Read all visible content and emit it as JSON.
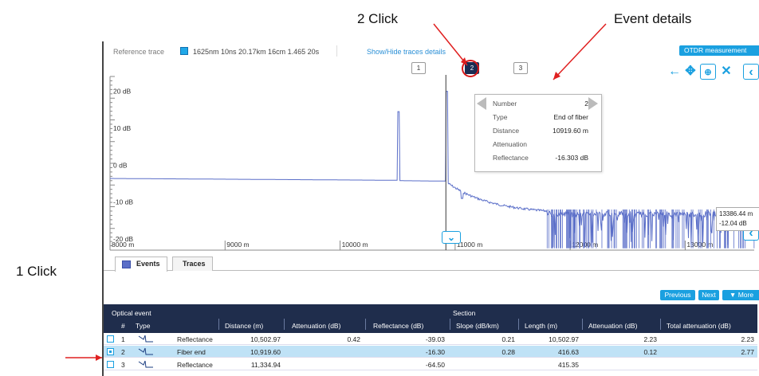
{
  "annotations": {
    "click2": "2 Click",
    "event_details": "Event details",
    "click1": "1 Click"
  },
  "info_bar": {
    "reference_label": "Reference trace",
    "trace_description": "1625nm 10ns 20.17km 16cm 1.465 20s",
    "show_hide": "Show/Hide traces details",
    "otdr_button": "OTDR measurement"
  },
  "markers": [
    "1",
    "2",
    "3"
  ],
  "chart": {
    "y_ticks": [
      "20 dB",
      "10 dB",
      "0 dB",
      "-10 dB",
      "-20 dB"
    ],
    "x_ticks": [
      "8000 m",
      "9000 m",
      "10000 m",
      "11000 m",
      "12000 m",
      "13000 m"
    ],
    "trace_color": "#5a6ec8",
    "marker_color": "#3a3a3a"
  },
  "event_popup": {
    "number_label": "Number",
    "number_value": "2",
    "type_label": "Type",
    "type_value": "End of fiber",
    "distance_label": "Distance",
    "distance_value": "10919.60 m",
    "attenuation_label": "Attenuation",
    "attenuation_value": "",
    "reflectance_label": "Reflectance",
    "reflectance_value": "-16.303 dB"
  },
  "cursor_readout": {
    "distance": "13386.44 m",
    "level": "-12.04 dB"
  },
  "tabs": {
    "events": "Events",
    "traces": "Traces"
  },
  "pager": {
    "previous": "Previous",
    "next": "Next",
    "more": "▼ More"
  },
  "table": {
    "group_optical": "Optical event",
    "group_section": "Section",
    "headers": {
      "num": "#",
      "type": "Type",
      "distance": "Distance (m)",
      "attenuation": "Attenuation (dB)",
      "reflectance": "Reflectance (dB)",
      "slope": "Slope (dB/km)",
      "length": "Length (m)",
      "sec_attenuation": "Attenuation (dB)",
      "total_attenuation": "Total attenuation (dB)"
    },
    "rows": [
      {
        "num": "1",
        "type": "Reflectance",
        "distance": "10,502.97",
        "attenuation": "0.42",
        "reflectance": "-39.03",
        "slope": "0.21",
        "length": "10,502.97",
        "sec_attenuation": "2.23",
        "total": "2.23",
        "checked": false,
        "selected": false
      },
      {
        "num": "2",
        "type": "Fiber end",
        "distance": "10,919.60",
        "attenuation": "",
        "reflectance": "-16.30",
        "slope": "0.28",
        "length": "416.63",
        "sec_attenuation": "0.12",
        "total": "2.77",
        "checked": true,
        "selected": true
      },
      {
        "num": "3",
        "type": "Reflectance",
        "distance": "11,334.94",
        "attenuation": "",
        "reflectance": "-64.50",
        "slope": "",
        "length": "415.35",
        "sec_attenuation": "",
        "total": "",
        "checked": false,
        "selected": false
      }
    ]
  }
}
